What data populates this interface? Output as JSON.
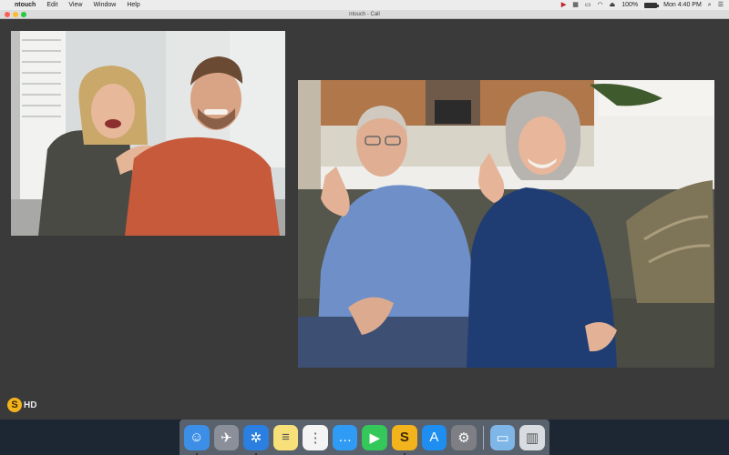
{
  "menubar": {
    "apple_icon": "apple-icon",
    "app_name": "ntouch",
    "items": [
      "Edit",
      "View",
      "Window",
      "Help"
    ],
    "battery_percent": "100%",
    "battery_level": 1.0,
    "datetime": "Mon 4:40 PM"
  },
  "window": {
    "title": "ntouch - Call"
  },
  "logo": {
    "letter": "S",
    "hd_label": "HD"
  },
  "dock": {
    "items": [
      {
        "name": "finder",
        "icon": "finder-icon",
        "color": "#3c8ee6",
        "running": true
      },
      {
        "name": "launchpad",
        "icon": "rocket-icon",
        "color": "#8a8f99",
        "running": false
      },
      {
        "name": "safari",
        "icon": "compass-icon",
        "color": "#2a7fe0",
        "running": true
      },
      {
        "name": "notes",
        "icon": "notes-icon",
        "color": "#f7e07a",
        "running": false
      },
      {
        "name": "reminders",
        "icon": "list-icon",
        "color": "#f4f4f4",
        "running": false
      },
      {
        "name": "messages",
        "icon": "chat-icon",
        "color": "#2f9bf4",
        "running": false
      },
      {
        "name": "facetime",
        "icon": "video-camera-icon",
        "color": "#34c759",
        "running": false
      },
      {
        "name": "ntouch",
        "icon": "ntouch-icon",
        "color": "#f3b31c",
        "running": true
      },
      {
        "name": "app-store",
        "icon": "app-store-icon",
        "color": "#1e8ef0",
        "running": false
      },
      {
        "name": "system-preferences",
        "icon": "gear-icon",
        "color": "#7d7f84",
        "running": false
      },
      {
        "name": "downloads",
        "icon": "folder-icon",
        "color": "#7fb6e8",
        "running": false
      },
      {
        "name": "trash",
        "icon": "trash-icon",
        "color": "#d8dbe0",
        "running": false
      }
    ]
  }
}
